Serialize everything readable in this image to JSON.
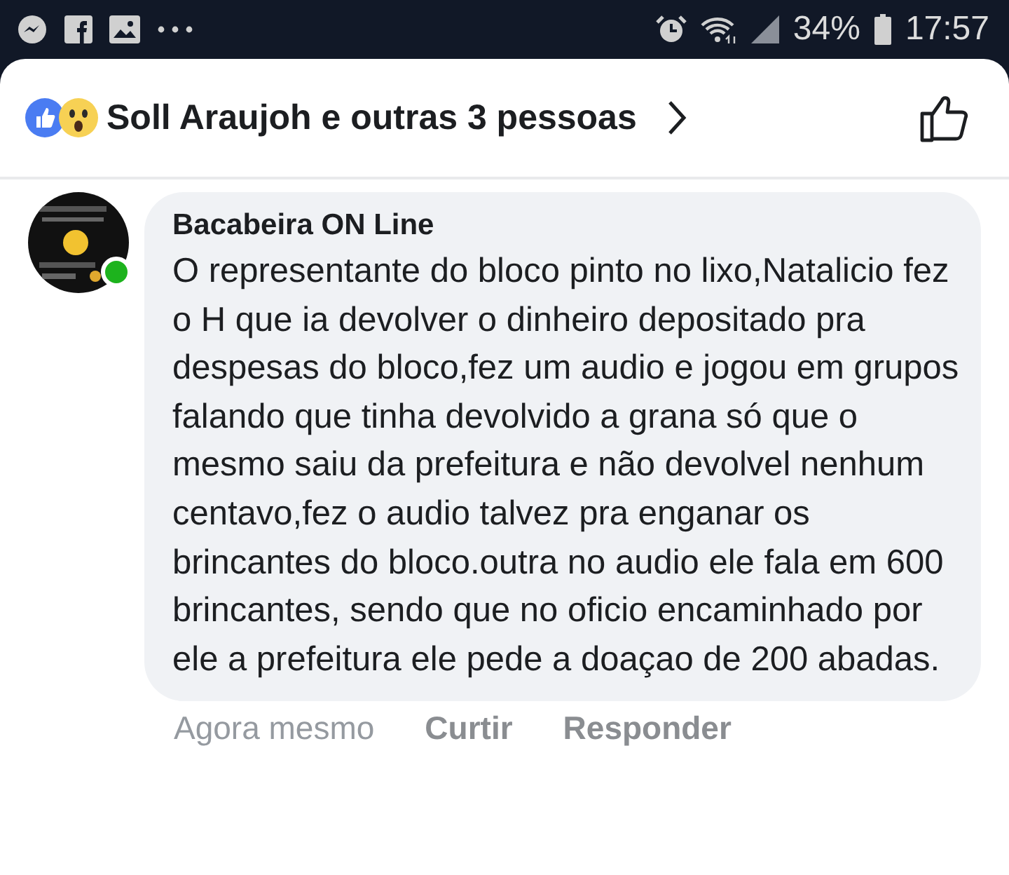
{
  "status_bar": {
    "battery": "34%",
    "time": "17:57"
  },
  "reactions": {
    "summary": "Soll Araujoh e outras 3 pessoas"
  },
  "comment": {
    "author": "Bacabeira ON Line",
    "online": true,
    "text": "O representante do bloco pinto no lixo,Natalicio fez o H que ia devolver o dinheiro depositado pra despesas do bloco,fez um audio e jogou em grupos falando que tinha devolvido a grana só que o mesmo saiu da prefeitura e não devolvel nenhum centavo,fez o audio talvez pra enganar os brincantes do bloco.outra no audio ele fala em 600 brincantes, sendo que no oficio encaminhado por ele a prefeitura ele pede a doaçao de 200 abadas."
  },
  "actions": [
    {
      "label": "Agora mesmo",
      "kind": "time"
    },
    {
      "label": "Curtir",
      "kind": "link"
    },
    {
      "label": "Responder",
      "kind": "link"
    }
  ]
}
